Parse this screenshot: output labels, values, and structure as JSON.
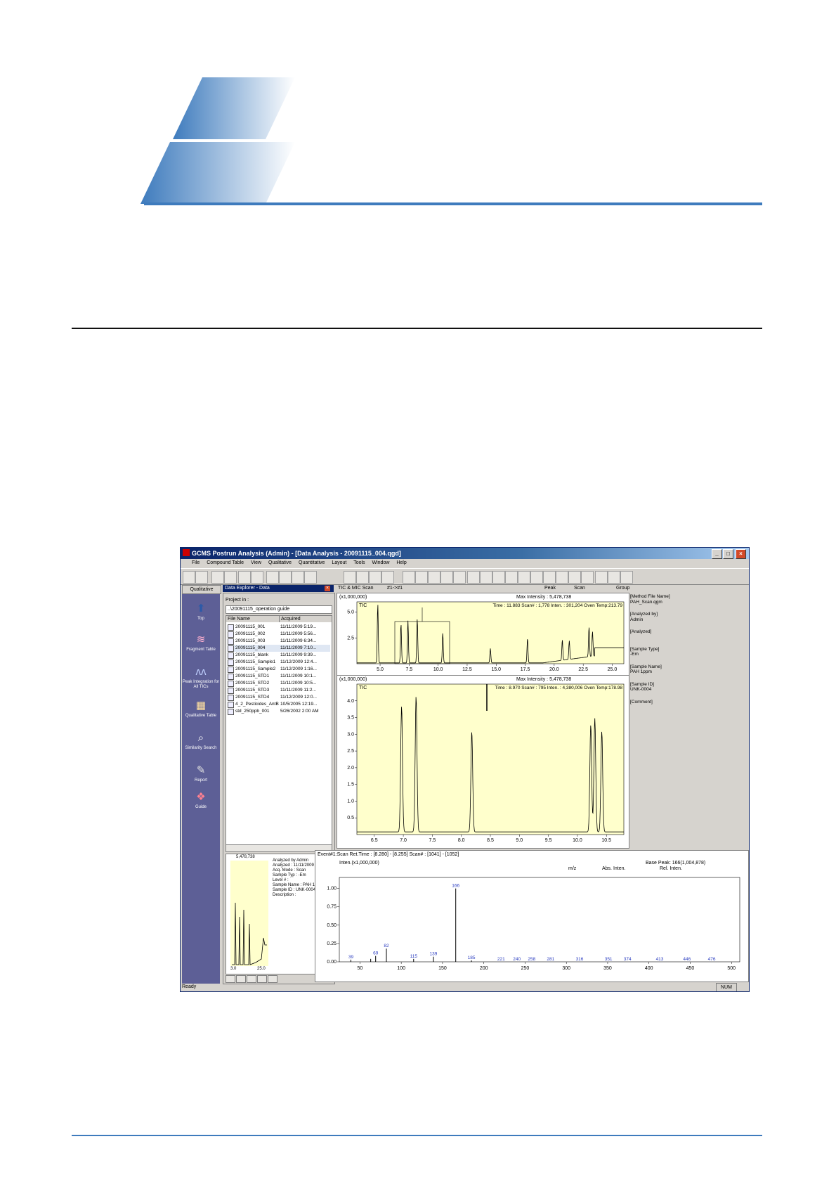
{
  "window": {
    "title": "GCMS Postrun Analysis (Admin) - [Data Analysis - 20091115_004.qgd]",
    "menu": [
      "File",
      "Compound Table",
      "View",
      "Qualitative",
      "Quantitative",
      "Layout",
      "Tools",
      "Window",
      "Help"
    ],
    "status_left": "Ready",
    "status_right": "NUM"
  },
  "sidebar": {
    "header": "Qualitative",
    "items": [
      {
        "label": "Top",
        "icon": "top-arrow-icon"
      },
      {
        "label": "Fragment Table",
        "icon": "fragment-table-icon"
      },
      {
        "label": "Peak Integration for All TICs",
        "icon": "peak-integration-icon"
      },
      {
        "label": "Qualitative Table",
        "icon": "qualitative-table-icon"
      },
      {
        "label": "Similarity Search",
        "icon": "similarity-search-icon"
      },
      {
        "label": "Report",
        "icon": "report-icon"
      },
      {
        "label": "Guide",
        "icon": "guide-icon"
      }
    ]
  },
  "explorer": {
    "title": "Data Explorer - Data",
    "project_label": "Project in :",
    "project_value": "..\\20091115_operation guide",
    "columns": [
      "File Name",
      "Acquired"
    ],
    "files": [
      {
        "name": "20091115_001",
        "acquired": "11/11/2009 5:19..."
      },
      {
        "name": "20091115_002",
        "acquired": "11/11/2009 5:56..."
      },
      {
        "name": "20091115_003",
        "acquired": "11/11/2009 6:34..."
      },
      {
        "name": "20091115_004",
        "acquired": "11/11/2009 7:10..."
      },
      {
        "name": "20091115_blank",
        "acquired": "11/11/2009 9:39..."
      },
      {
        "name": "20091115_Sample1",
        "acquired": "11/12/2009 12:4..."
      },
      {
        "name": "20091115_Sample2",
        "acquired": "11/12/2009 1:16..."
      },
      {
        "name": "20091115_STD1",
        "acquired": "11/11/2009 10:1..."
      },
      {
        "name": "20091115_STD2",
        "acquired": "11/11/2009 10:5..."
      },
      {
        "name": "20091115_STD3",
        "acquired": "11/11/2009 11:2..."
      },
      {
        "name": "20091115_STD4",
        "acquired": "11/12/2009 12:0..."
      },
      {
        "name": "4_2_Pesticides_AntB",
        "acquired": "10/5/2005 12:19..."
      },
      {
        "name": "std_250ppb_001",
        "acquired": "5/26/2002 2:00 AM"
      }
    ],
    "preview_max": "5,478,738",
    "preview_x_ticks": [
      "3.0",
      "25.0"
    ],
    "info": [
      "Analyzed by Admin",
      "Analyzed : 11/11/2009",
      "Acq. Mode : Scan",
      "Sample Typ : -Em",
      "Level # :",
      "Sample Name : PAH 1ppm",
      "Sample ID : UNK-0004",
      "Description :"
    ]
  },
  "chromatogram_header": {
    "mode": "TIC & MIC  Scan",
    "range": "#1->#1",
    "nav": [
      "Peak",
      "Scan",
      "Group"
    ]
  },
  "tic_top": {
    "scale": "(x1,000,000)",
    "label": "TIC",
    "max_intensity": "Max Intensity : 5,478,738",
    "readout": "Time : 11.883  Scan# : 1,778  Inten. : 301,204  Oven Temp:213.79",
    "y_ticks": [
      "5.0",
      "2.5"
    ],
    "x_ticks": [
      "5.0",
      "7.5",
      "10.0",
      "12.5",
      "15.0",
      "17.5",
      "20.0",
      "22.5",
      "25.0"
    ]
  },
  "tic_zoom": {
    "scale": "(x1,000,000)",
    "label": "TIC",
    "max_intensity": "Max Intensity : 5,478,738",
    "readout": "Time : 8.970  Scan# : 795  Inten. : 4,380,006  Oven Temp:178.98",
    "y_ticks": [
      "4.0",
      "3.5",
      "3.0",
      "2.5",
      "2.0",
      "1.5",
      "1.0",
      "0.5"
    ],
    "x_ticks": [
      "6.5",
      "7.0",
      "7.5",
      "8.0",
      "8.5",
      "9.0",
      "9.5",
      "10.0",
      "10.5"
    ]
  },
  "method_info": [
    {
      "label": "[Method File Name]",
      "value": "PAH_Scan.qgm"
    },
    {
      "label": "[Analyzed by]",
      "value": "Admin"
    },
    {
      "label": "[Analyzed]",
      "value": ""
    },
    {
      "label": "[Sample Type]",
      "value": "-Em"
    },
    {
      "label": "[Sample Name]",
      "value": "PAH 1ppm"
    },
    {
      "label": "[Sample ID]",
      "value": "UNK-0004"
    },
    {
      "label": "[Comment]",
      "value": ""
    }
  ],
  "spectrum": {
    "header": "Event#1:Scan  Ret.Time : [8.280] - [8.255]  Scan# : [1041] - [1052]",
    "scale": "Inten.(x1,000,000)",
    "base_peak": "Base Peak: 166(1,004,878)",
    "cols": [
      "m/z",
      "Abs. Inten.",
      "Rel. Inten."
    ],
    "y_ticks": [
      "1.00",
      "0.75",
      "0.50",
      "0.25",
      "0.00"
    ],
    "x_ticks": [
      "50",
      "100",
      "150",
      "200",
      "250",
      "300",
      "350",
      "400",
      "450",
      "500"
    ],
    "peak_labels": [
      "39",
      "69",
      "82",
      "115",
      "139",
      "166",
      "185",
      "221",
      "240",
      "258",
      "281",
      "316",
      "351",
      "374",
      "413",
      "446",
      "476"
    ]
  },
  "chart_data": [
    {
      "type": "line",
      "title": "TIC",
      "xlim": [
        3.0,
        26.0
      ],
      "ylim": [
        0,
        6.0
      ],
      "peaks": [
        [
          4.8,
          5.7
        ],
        [
          6.8,
          3.8
        ],
        [
          7.4,
          4.1
        ],
        [
          8.2,
          4.3
        ],
        [
          10.4,
          2.9
        ],
        [
          14.5,
          1.4
        ],
        [
          17.7,
          2.4
        ],
        [
          20.7,
          2.0
        ],
        [
          21.3,
          1.8
        ],
        [
          23.0,
          2.9
        ],
        [
          23.3,
          2.4
        ]
      ]
    },
    {
      "type": "line",
      "title": "TIC",
      "xlim": [
        6.2,
        10.8
      ],
      "ylim": [
        0,
        4.5
      ],
      "peaks": [
        [
          6.97,
          3.75
        ],
        [
          7.22,
          4.05
        ],
        [
          8.18,
          3.0
        ],
        [
          10.23,
          3.2
        ],
        [
          10.3,
          3.4
        ],
        [
          10.42,
          3.0
        ]
      ]
    },
    {
      "type": "bar",
      "title": "Spectrum",
      "xlim": [
        25,
        510
      ],
      "ylim": [
        0,
        1.15
      ],
      "x": [
        39,
        63,
        69,
        82,
        115,
        139,
        166,
        185
      ],
      "values": [
        0.03,
        0.04,
        0.08,
        0.18,
        0.04,
        0.07,
        1.0,
        0.02
      ]
    }
  ]
}
